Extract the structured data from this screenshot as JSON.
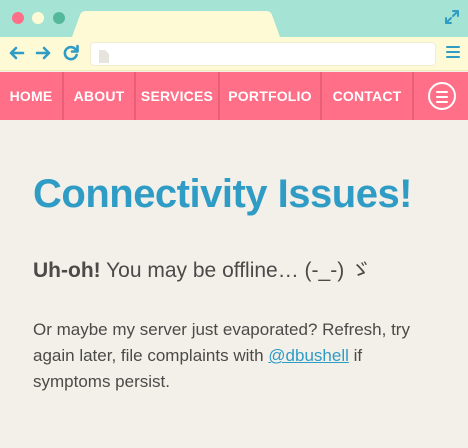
{
  "browser": {
    "url": "",
    "icons": [
      "close-dot",
      "minimize-dot",
      "maximize-dot",
      "expand-icon",
      "back-arrow-icon",
      "forward-arrow-icon",
      "reload-icon",
      "page-icon",
      "menu-icon"
    ],
    "colors": {
      "titlebar": "#a5e4d4",
      "toolbar": "#fffad6",
      "accent": "#2f9cc6",
      "close": "#ff6f87",
      "maximize": "#56b89a"
    }
  },
  "nav": {
    "items": [
      "HOME",
      "ABOUT",
      "SERVICES",
      "PORTFOLIO",
      "CONTACT"
    ],
    "menu_icon": "hamburger-circle-icon",
    "colors": {
      "background": "#ff6f87",
      "separator": "#e85f76",
      "text": "#ffffff"
    }
  },
  "page": {
    "heading": "Connectivity Issues!",
    "lead_bold": "Uh-oh!",
    "lead_text": " You may be offline… (-_-) ゞ",
    "body_pre": "Or maybe my server just evaporated? Refresh, try again later, file complaints with ",
    "body_link": "@dbushell",
    "body_post": " if symptoms persist.",
    "colors": {
      "background": "#f3f0e9",
      "heading": "#2f9cc6",
      "text": "#4a4a48",
      "link": "#2f9cc6"
    }
  }
}
